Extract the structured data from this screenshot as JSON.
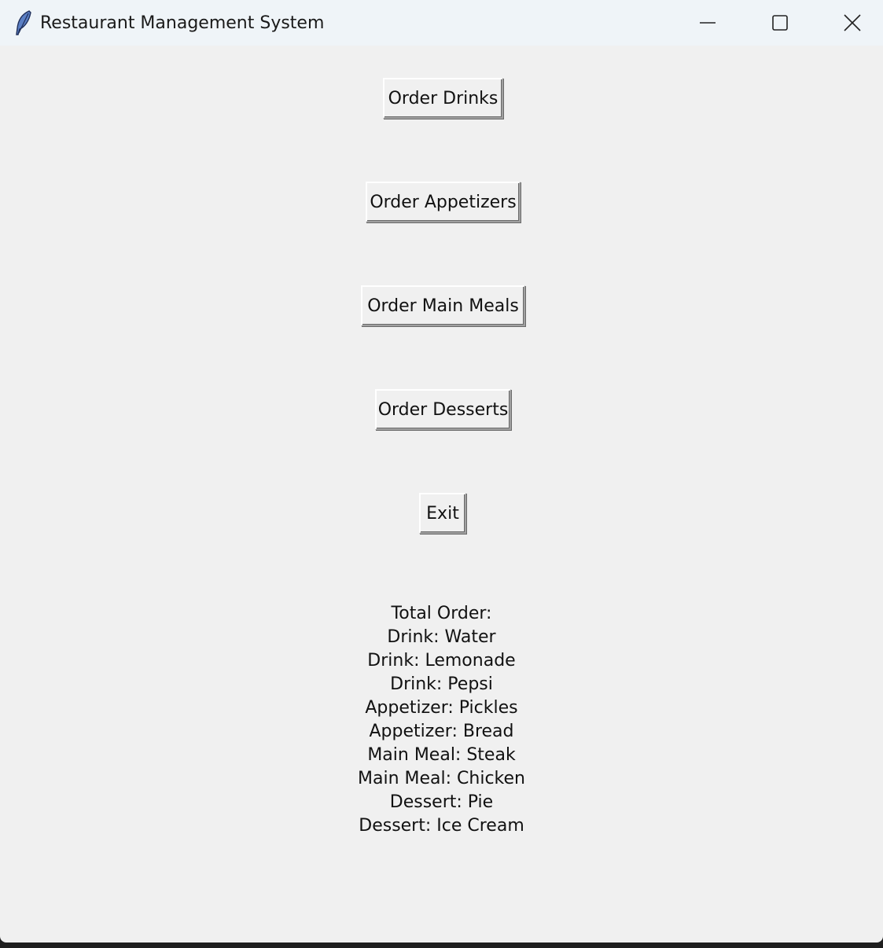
{
  "window": {
    "title": "Restaurant Management System",
    "icon": "feather-icon",
    "controls": {
      "minimize": "minimize-icon",
      "maximize": "maximize-icon",
      "close": "close-icon"
    }
  },
  "buttons": {
    "order_drinks": "Order Drinks",
    "order_appetizers": "Order Appetizers",
    "order_main_meals": "Order Main Meals",
    "order_desserts": "Order Desserts",
    "exit": "Exit"
  },
  "order": {
    "heading": "Total Order:",
    "items": [
      "Drink: Water",
      "Drink: Lemonade",
      "Drink: Pepsi",
      "Appetizer: Pickles",
      "Appetizer: Bread",
      "Main Meal: Steak",
      "Main Meal: Chicken",
      "Dessert: Pie",
      "Dessert: Ice Cream"
    ]
  },
  "colors": {
    "titlebar": "#eff4f8",
    "window_bg": "#f0f0f0"
  }
}
